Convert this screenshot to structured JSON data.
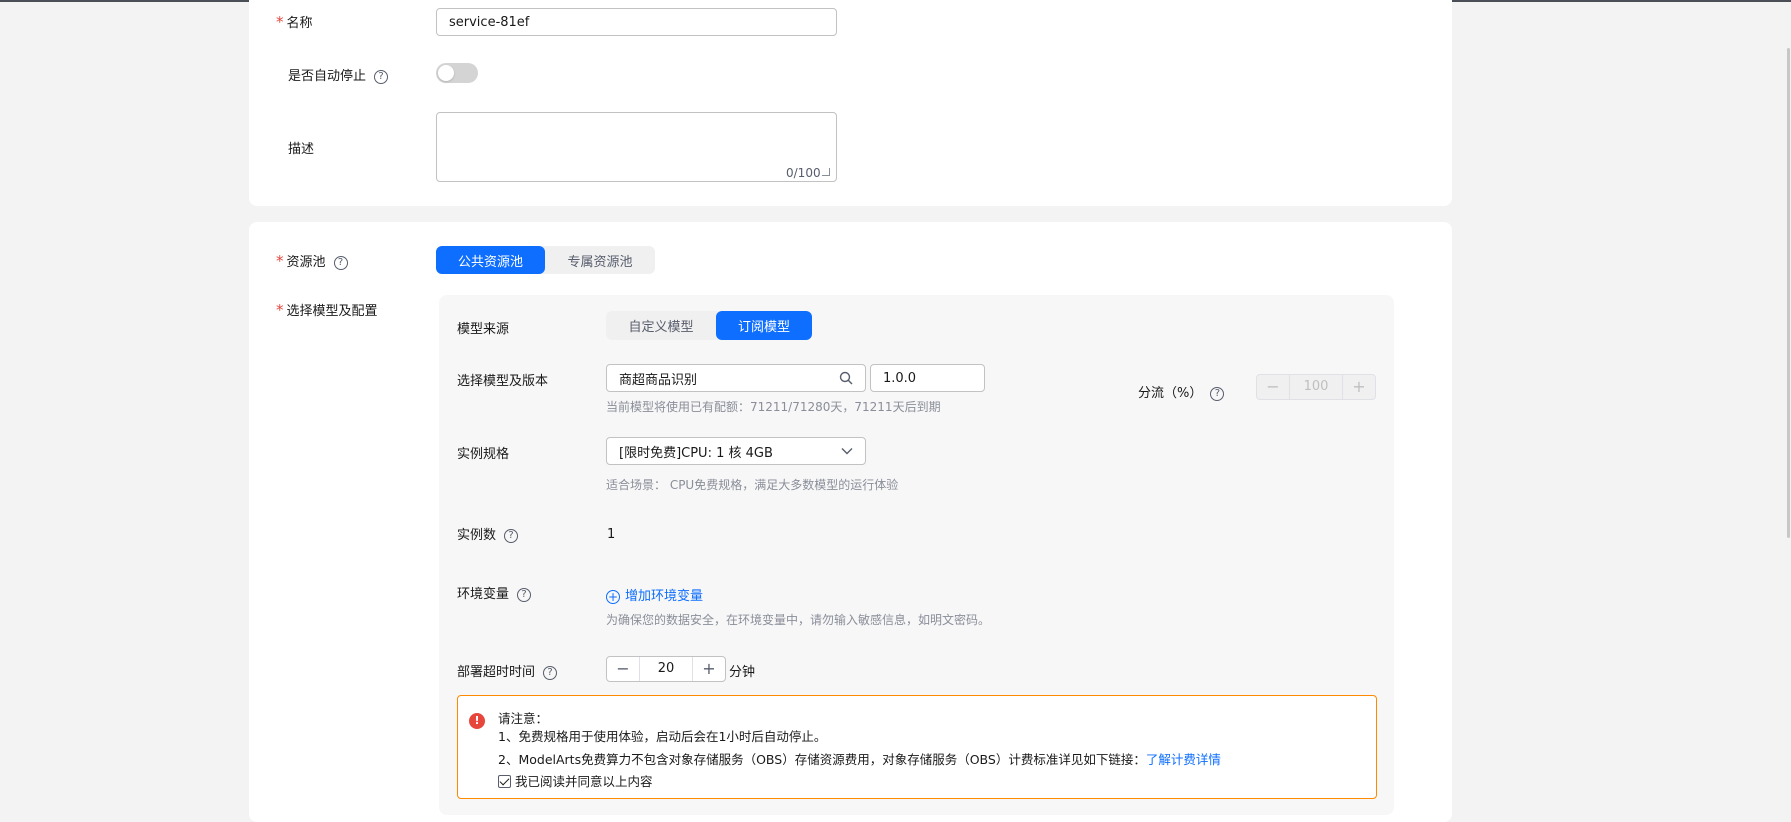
{
  "basic": {
    "name_label": "名称",
    "name_value": "service-81ef",
    "autostop_label": "是否自动停止",
    "desc_label": "描述",
    "desc_counter": "0/100"
  },
  "resource": {
    "pool_label": "资源池",
    "pool_options": [
      "公共资源池",
      "专属资源池"
    ],
    "model_config_label": "选择模型及配置"
  },
  "model": {
    "source_label": "模型来源",
    "source_options": [
      "自定义模型",
      "订阅模型"
    ],
    "select_label": "选择模型及版本",
    "model_name": "商超商品识别",
    "version": "1.0.0",
    "quota_hint": "当前模型将使用已有配额：71211/71280天，71211天后到期",
    "traffic_label": "分流（%）",
    "traffic_value": "100",
    "spec_label": "实例规格",
    "spec_value": "[限时免费]CPU: 1 核 4GB",
    "spec_hint": "适合场景： CPU免费规格，满足大多数模型的运行体验",
    "count_label": "实例数",
    "count_value": "1",
    "env_label": "环境变量",
    "env_add": "增加环境变量",
    "env_hint": "为确保您的数据安全，在环境变量中，请勿输入敏感信息，如明文密码。",
    "timeout_label": "部署超时时间",
    "timeout_value": "20",
    "timeout_unit": "分钟"
  },
  "notice": {
    "title": "请注意：",
    "line1": "1、免费规格用于使用体验，启动后会在1小时后自动停止。",
    "line2": "2、ModelArts免费算力不包含对象存储服务（OBS）存储资源费用，对象存储服务（OBS）计费标准详见如下链接：",
    "link": "了解计费详情",
    "agree": "我已阅读并同意以上内容"
  },
  "colors": {
    "primary": "#0d6eff",
    "required": "#e6463c",
    "warning_border": "#ff8a00"
  }
}
